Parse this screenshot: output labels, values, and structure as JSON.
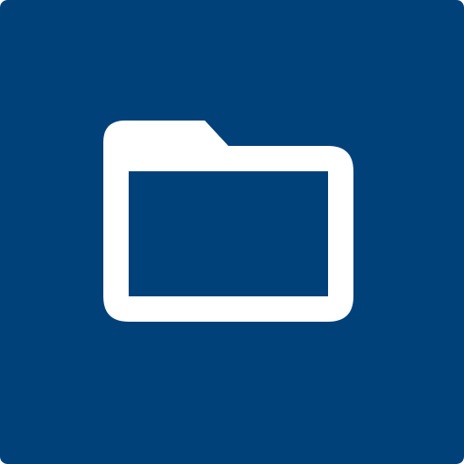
{
  "app_icon": {
    "icon": "folder-icon",
    "background_color": "#00417A",
    "glyph_color": "#FFFFFF"
  }
}
